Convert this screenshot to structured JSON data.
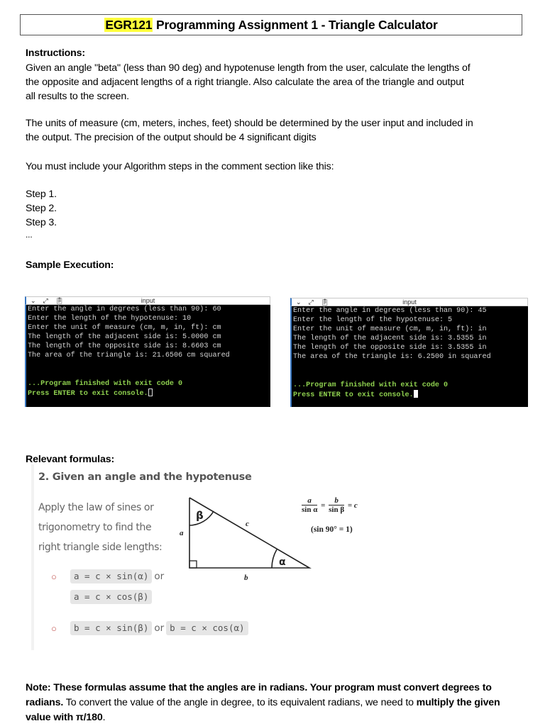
{
  "title": {
    "highlight": "EGR121",
    "rest": " Programming Assignment 1 - Triangle Calculator",
    "highlight_color": "#ffff3b"
  },
  "instructions": {
    "heading": "Instructions:",
    "paragraph1_lines": [
      "Given an angle \"beta\" (less than 90 deg) and hypotenuse length from the user, calculate the lengths of",
      "the opposite and adjacent lengths of a right triangle. Also calculate the area of the triangle and output",
      "all results to the screen."
    ],
    "paragraph2_lines": [
      "The units of measure (cm, meters, inches, feet) should be determined by the user input and included in",
      "the output.  The precision of the output should be 4 significant digits"
    ],
    "paragraph3": "You must include your Algorithm steps in the comment section like this:",
    "steps": [
      "Step 1.",
      "Step 2.",
      "Step 3.",
      "..."
    ]
  },
  "sample_execution": {
    "heading": "Sample Execution:",
    "terminals": [
      {
        "toolbar_title": "input",
        "toolbar_icons": [
          "chevron-down-icon",
          "expand-icon",
          "clipboard-icon"
        ],
        "lines": [
          "Enter the angle in degrees (less than 90): 60",
          "Enter the length of the hypotenuse: 10",
          "Enter the unit of measure (cm, m, in, ft): cm",
          "The length of the adjacent side is: 5.0000 cm",
          "The length of the opposite side is: 8.6603 cm",
          "The area of the triangle is: 21.6506 cm squared"
        ],
        "status_lines": [
          "...Program finished with exit code 0",
          "Press ENTER to exit console."
        ],
        "cursor": "hollow"
      },
      {
        "toolbar_title": "input",
        "toolbar_icons": [
          "chevron-down-icon",
          "expand-icon",
          "clipboard-icon"
        ],
        "lines": [
          "Enter the angle in degrees (less than 90): 45",
          "Enter the length of the hypotenuse: 5",
          "Enter the unit of measure (cm, m, in, ft): in",
          "The length of the adjacent side is: 3.5355 in",
          "The length of the opposite side is: 3.5355 in",
          "The area of the triangle is: 6.2500 in squared"
        ],
        "status_lines": [
          "...Program finished with exit code 0",
          "Press ENTER to exit console."
        ],
        "cursor": "solid"
      }
    ]
  },
  "formulas": {
    "heading": "Relevant formulas:",
    "subheading": "2. Given an angle and the hypotenuse",
    "description_lines": [
      "Apply the law of sines or",
      "trigonometry to find the",
      "right triangle side lengths:"
    ],
    "bullet_glyph": "○",
    "bullet1": {
      "code1": "a = c × sin(α)",
      "or": "or",
      "code2": "a = c × cos(β)"
    },
    "bullet2": {
      "code1": "b = c × sin(β)",
      "or": "or",
      "code2": "b = c × cos(α)"
    },
    "diagram_labels": {
      "a": "a",
      "b": "b",
      "c": "c",
      "alpha": "α",
      "beta": "β"
    },
    "law_of_sines": {
      "num1": "a",
      "den1": "sin α",
      "num2": "b",
      "den2": "sin β",
      "eq": "=",
      "result": "= c",
      "note": "(sin 90° = 1)"
    }
  },
  "note": {
    "bold1": "Note: These formulas assume that the angles are in radians. Your program must convert degrees to radians.",
    "normal": " To convert the value of the angle in degree, to its equivalent radians, we need to ",
    "bold2": "multiply the given value with π/180",
    "end": "."
  }
}
